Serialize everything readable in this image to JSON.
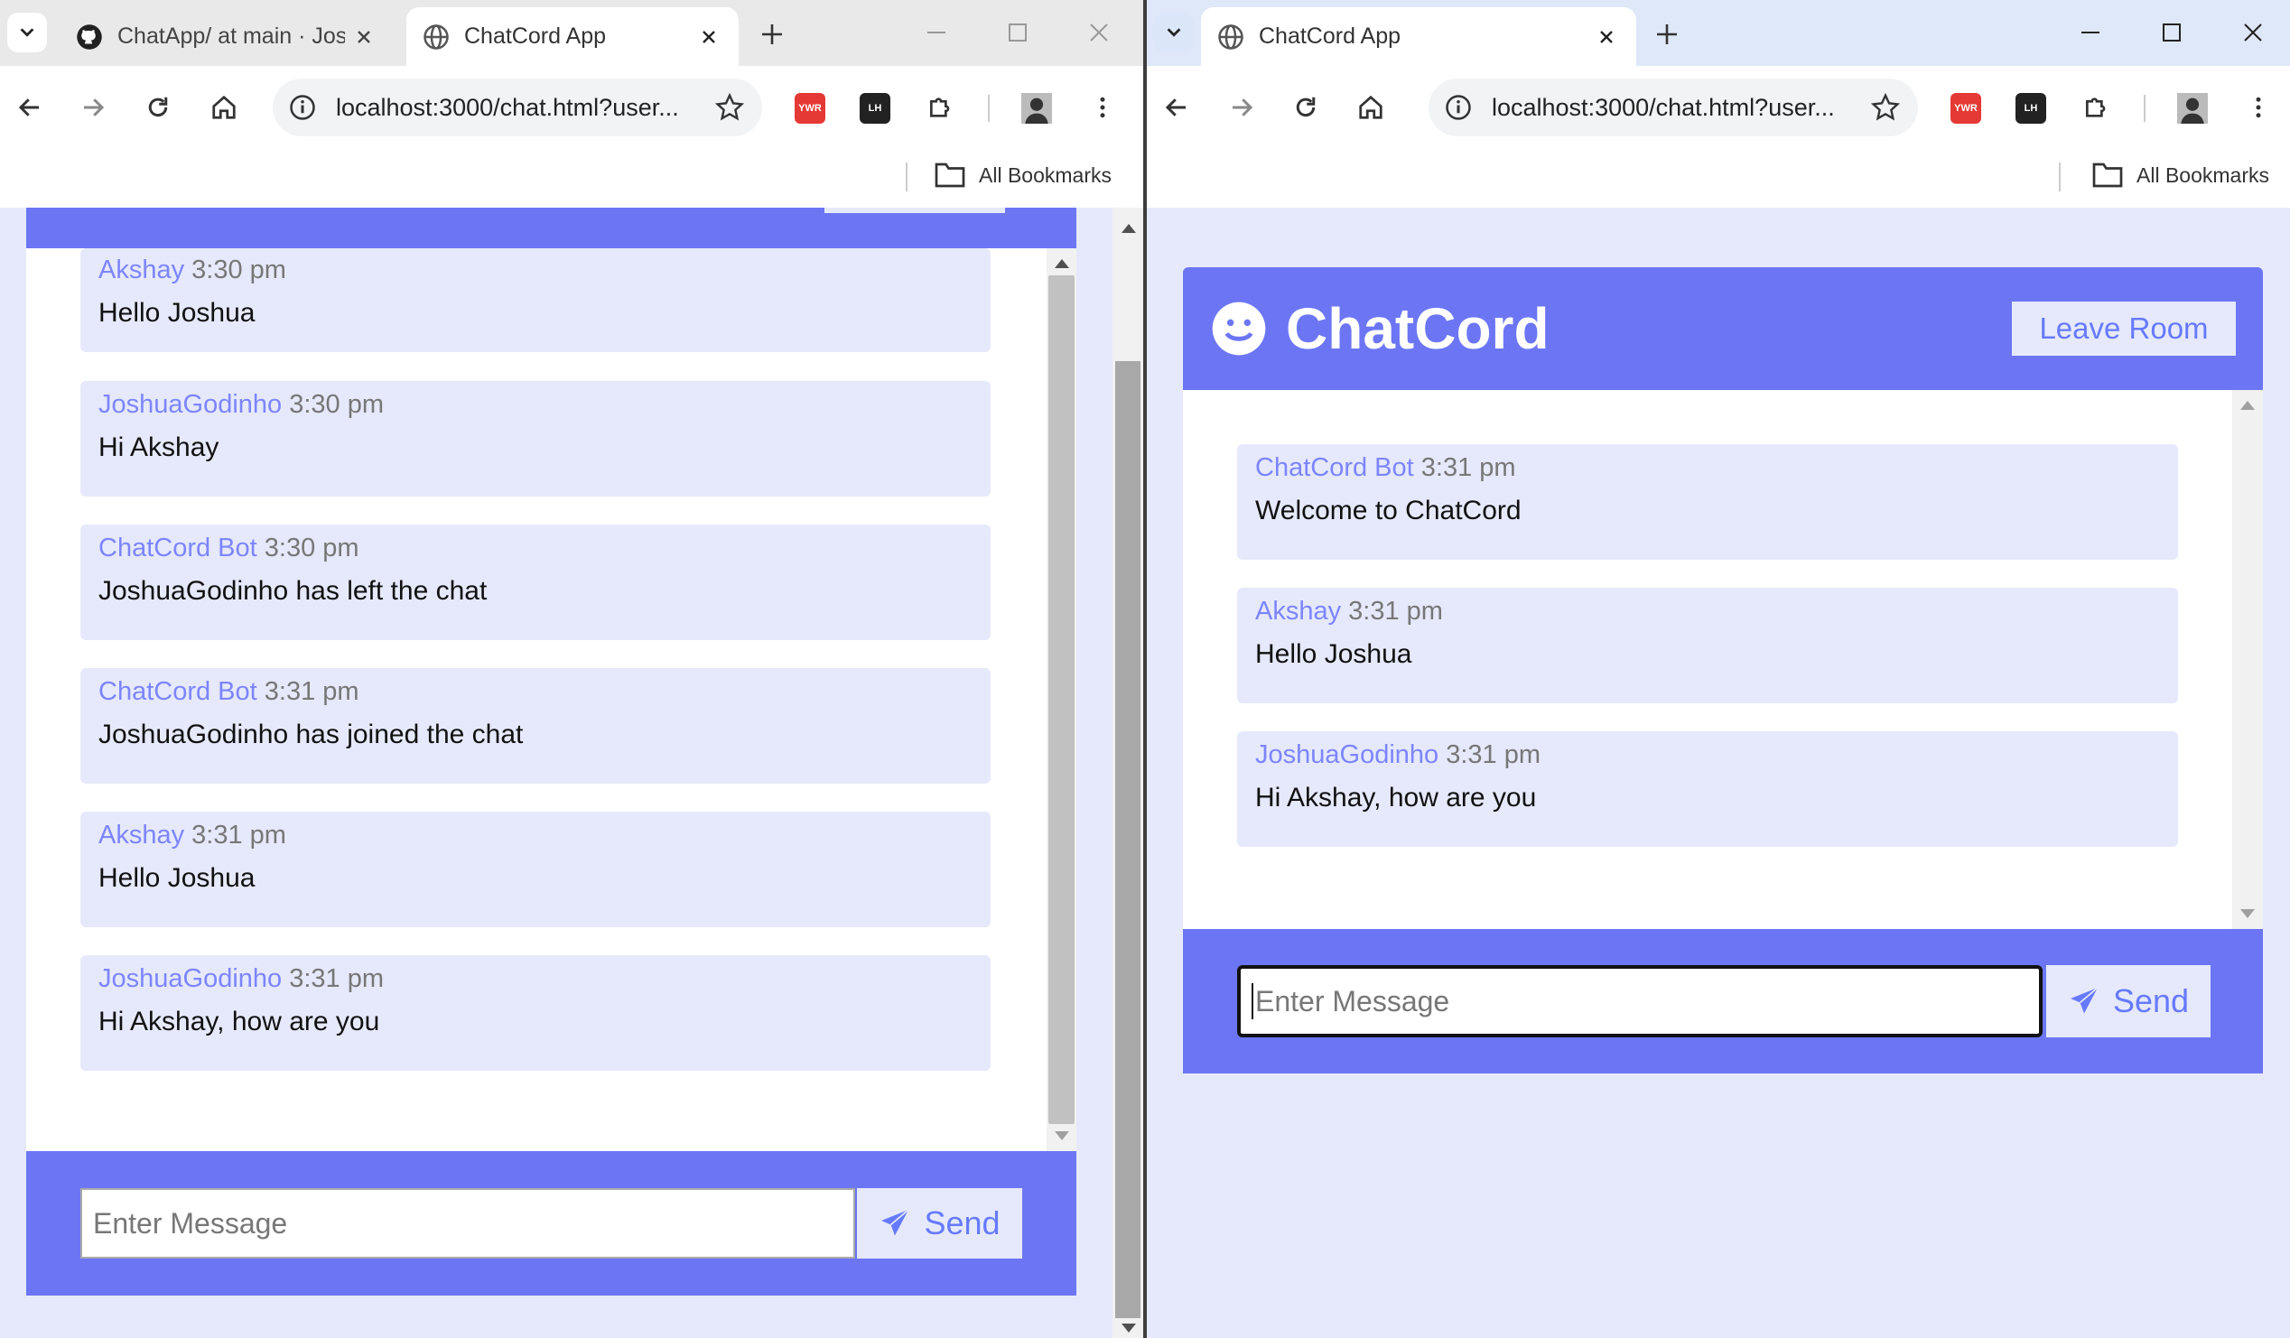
{
  "left": {
    "tabs": [
      {
        "title": "ChatApp/ at main · Jos"
      },
      {
        "title": "ChatCord App"
      }
    ],
    "url": "localhost:3000/chat.html?user...",
    "bookmarks_label": "All Bookmarks",
    "messages": [
      {
        "user": "Akshay",
        "time": "3:30 pm",
        "text": "Hello Joshua"
      },
      {
        "user": "JoshuaGodinho",
        "time": "3:30 pm",
        "text": "Hi Akshay"
      },
      {
        "user": "ChatCord Bot",
        "time": "3:30 pm",
        "text": "JoshuaGodinho has left the chat"
      },
      {
        "user": "ChatCord Bot",
        "time": "3:31 pm",
        "text": "JoshuaGodinho has joined the chat"
      },
      {
        "user": "Akshay",
        "time": "3:31 pm",
        "text": "Hello Joshua"
      },
      {
        "user": "JoshuaGodinho",
        "time": "3:31 pm",
        "text": "Hi Akshay, how are you"
      }
    ],
    "input_placeholder": "Enter Message",
    "send_label": "Send"
  },
  "right": {
    "tabs": [
      {
        "title": "ChatCord App"
      }
    ],
    "url": "localhost:3000/chat.html?user...",
    "bookmarks_label": "All Bookmarks",
    "app_title": "ChatCord",
    "leave_label": "Leave Room",
    "messages": [
      {
        "user": "ChatCord Bot",
        "time": "3:31 pm",
        "text": "Welcome to ChatCord"
      },
      {
        "user": "Akshay",
        "time": "3:31 pm",
        "text": "Hello Joshua"
      },
      {
        "user": "JoshuaGodinho",
        "time": "3:31 pm",
        "text": "Hi Akshay, how are you"
      }
    ],
    "input_placeholder": "Enter Message",
    "send_label": "Send"
  },
  "colors": {
    "primary": "#6c76f4",
    "light": "#e6e9fb",
    "username": "#7c85ff",
    "time": "#777777"
  },
  "icons": {
    "tab_search": "chevron-down-icon",
    "github": "github-icon",
    "globe": "globe-icon",
    "close": "close-icon",
    "new_tab": "plus-icon",
    "back": "back-arrow-icon",
    "forward": "forward-arrow-icon",
    "reload": "reload-icon",
    "home": "home-icon",
    "site_info": "info-icon",
    "bookmark_star": "star-icon",
    "extensions": "puzzle-icon",
    "profile": "avatar",
    "menu": "kebab-menu-icon",
    "folder": "folder-icon",
    "smile": "smile-icon",
    "send": "paper-plane-icon"
  }
}
